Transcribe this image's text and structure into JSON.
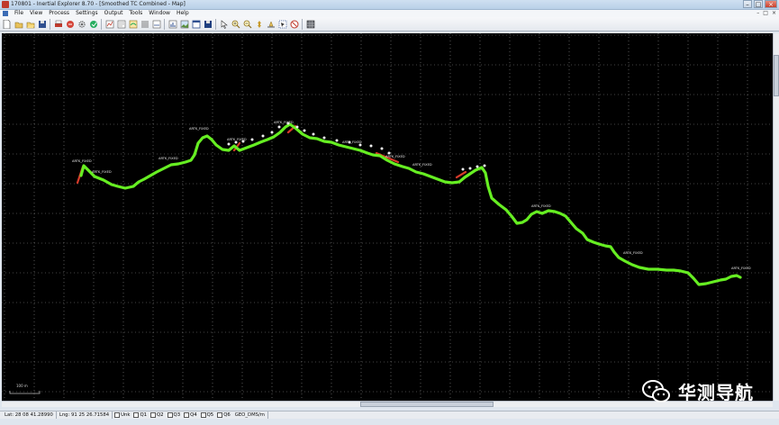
{
  "window": {
    "title": "170801 - Inertial Explorer 8.70 - [Smoothed TC Combined - Map]",
    "buttons": [
      "–",
      "□",
      "×"
    ]
  },
  "menu": {
    "items": [
      "File",
      "View",
      "Process",
      "Settings",
      "Output",
      "Tools",
      "Window",
      "Help"
    ],
    "controls": [
      "–",
      "□",
      "×"
    ]
  },
  "toolbar": {
    "icons": [
      "new-icon",
      "open-icon",
      "open-folder-icon",
      "save-icon",
      "print-icon",
      "process-icon",
      "gear-icon",
      "process-icon",
      "plot-icon",
      "document-icon",
      "map-icon",
      "list-icon",
      "plot-icon",
      "chart-icon",
      "image-icon",
      "window-icon",
      "save-icon",
      "pointer-icon",
      "zoom-in-icon",
      "zoom-out-icon",
      "pan-icon",
      "measure-icon",
      "select-icon",
      "stop-icon",
      "grid-icon"
    ]
  },
  "map": {
    "background": "#000000",
    "track_color": "#66ee22",
    "scale_label": "100 m",
    "station_labels": [
      "ARTK_FIXED",
      "ARTK_FIXED",
      "ARTK_FIXED",
      "ARTK_FIXED",
      "ARTK_FIXED",
      "ARTK_FIXED",
      "ARTK_FIXED",
      "ARTK_FIXED",
      "ARTK_FIXED",
      "ARTK_FIXED",
      "ARTK_FIXED",
      "ARTK_FIXED"
    ]
  },
  "status": {
    "lat": "Lat: 28 08 41.28990",
    "lng": "Lng: 91 25 26.71584",
    "checks": [
      "Unk",
      "Q1",
      "Q2",
      "Q3",
      "Q4",
      "Q5",
      "Q6"
    ],
    "coord_system": "GEO_DMS/m"
  },
  "watermark": {
    "text": "华测导航"
  }
}
